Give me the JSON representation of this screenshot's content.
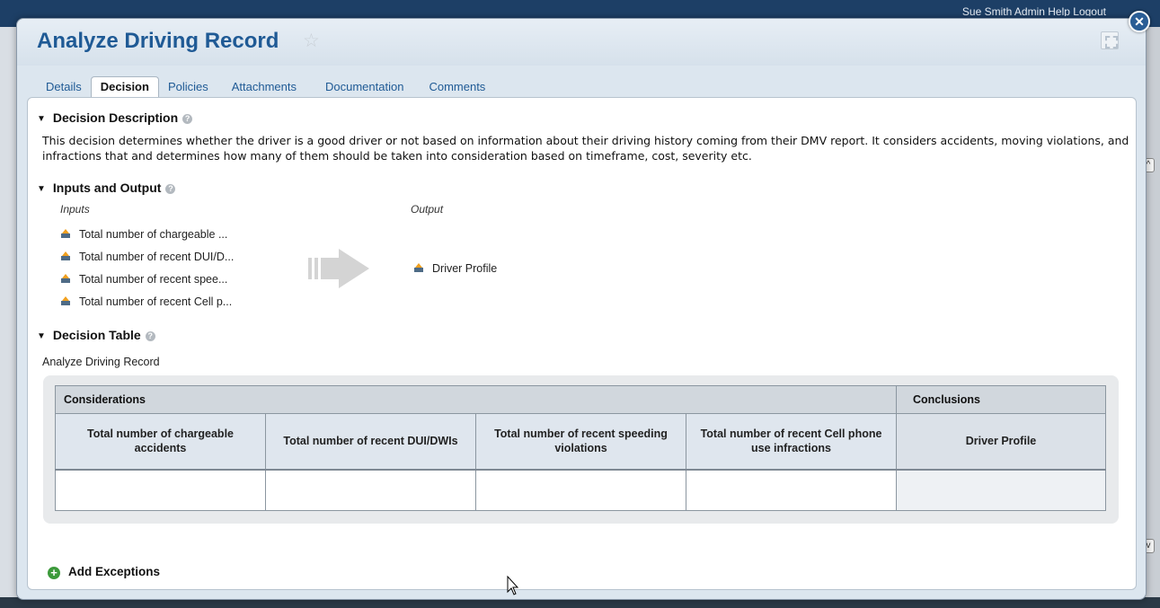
{
  "app": {
    "user_bar": "Sue Smith    Admin  Help  Logout"
  },
  "dialog": {
    "title": "Analyze Driving Record",
    "tabs": [
      {
        "label": "Details"
      },
      {
        "label": "Decision"
      },
      {
        "label": "Policies"
      },
      {
        "label": "Attachments"
      },
      {
        "label": "Documentation"
      },
      {
        "label": "Comments"
      }
    ],
    "active_tab": "Decision"
  },
  "description": {
    "heading": "Decision Description",
    "text": "This decision determines whether the driver is a good driver or not based on information about their driving history coming from their DMV report. It considers accidents, moving violations, and infractions that and determines how many of them should be taken into consideration based on timeframe, cost, severity etc."
  },
  "io": {
    "heading": "Inputs and Output",
    "inputs_label": "Inputs",
    "output_label": "Output",
    "inputs": [
      "Total number of chargeable ...",
      "Total number of recent DUI/D...",
      "Total number of recent spee...",
      "Total number of recent Cell p..."
    ],
    "output": "Driver Profile"
  },
  "decision_table": {
    "heading": "Decision Table",
    "caption": "Analyze Driving Record",
    "group_considerations": "Considerations",
    "group_conclusions": "Conclusions",
    "columns": [
      "Total number of chargeable accidents",
      "Total number of recent DUI/DWIs",
      "Total number of recent speeding violations",
      "Total number of recent Cell phone use infractions"
    ],
    "conclusion_column": "Driver Profile"
  },
  "actions": {
    "add_exceptions": "Add Exceptions"
  },
  "colors": {
    "title": "#1f5a95",
    "link": "#1f5a95",
    "add_icon": "#3c9a3b"
  }
}
